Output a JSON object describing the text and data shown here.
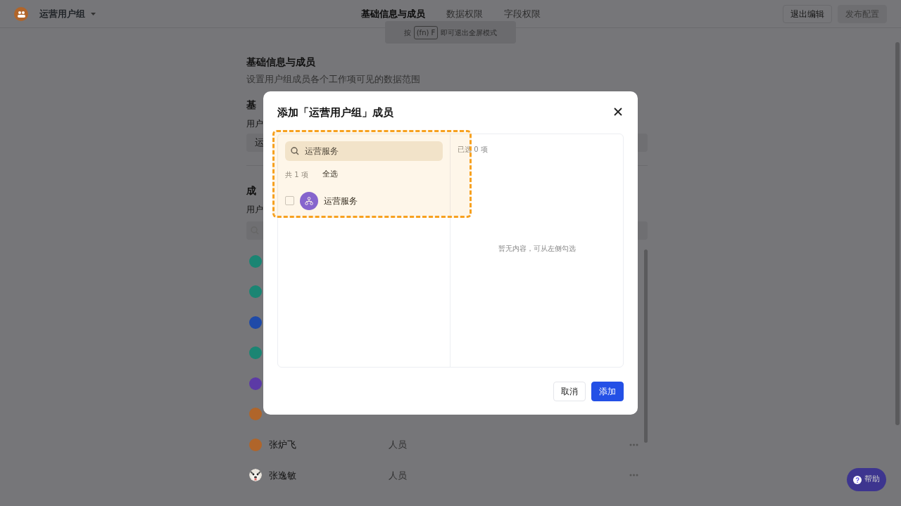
{
  "header": {
    "group_name": "运营用户组",
    "tabs": [
      {
        "label": "基础信息与成员",
        "selected": true
      },
      {
        "label": "数据权限",
        "selected": false
      },
      {
        "label": "字段权限",
        "selected": false
      }
    ],
    "buttons": [
      {
        "label": "退出编辑",
        "disabled": false
      },
      {
        "label": "发布配置",
        "disabled": true
      }
    ]
  },
  "toast": {
    "before": "按",
    "key": "(fn) F",
    "after": "即可退出全屏模式"
  },
  "page": {
    "title": "基础信息与成员",
    "subtitle": "设置用户组成员各个工作项可见的数据范围",
    "section_heading": "基",
    "field_label": "用户",
    "field_value": "运",
    "members_heading": "成",
    "members_label": "用户"
  },
  "members": [
    {
      "kind": "initials",
      "color": "#1b8573"
    },
    {
      "kind": "initials",
      "color": "#1b8573"
    },
    {
      "kind": "initials",
      "color": "#1f4aa8"
    },
    {
      "kind": "initials",
      "color": "#1b8573"
    },
    {
      "kind": "initials",
      "color": "#5c3aa6"
    },
    {
      "kind": "initials",
      "color": "#b0652a"
    },
    {
      "kind": "initials",
      "color": "#b0652a",
      "name": "张炉飞",
      "type": "人员"
    },
    {
      "kind": "picture",
      "name": "张逸敏",
      "type": "人员"
    }
  ],
  "dialog": {
    "title": "添加「运营用户组」成员",
    "highlighted": true,
    "search": {
      "value": "运营服务"
    },
    "count": "共 1 项",
    "select_all": "全选",
    "options": [
      {
        "label": "运营服务",
        "checked": false
      }
    ],
    "selected_count": "已选 0 项",
    "empty": "暂无内容，可从左侧勾选",
    "buttons": [
      {
        "label": "取消",
        "kind": "secondary"
      },
      {
        "label": "添加",
        "kind": "primary"
      }
    ]
  },
  "help": {
    "label": "帮助"
  }
}
